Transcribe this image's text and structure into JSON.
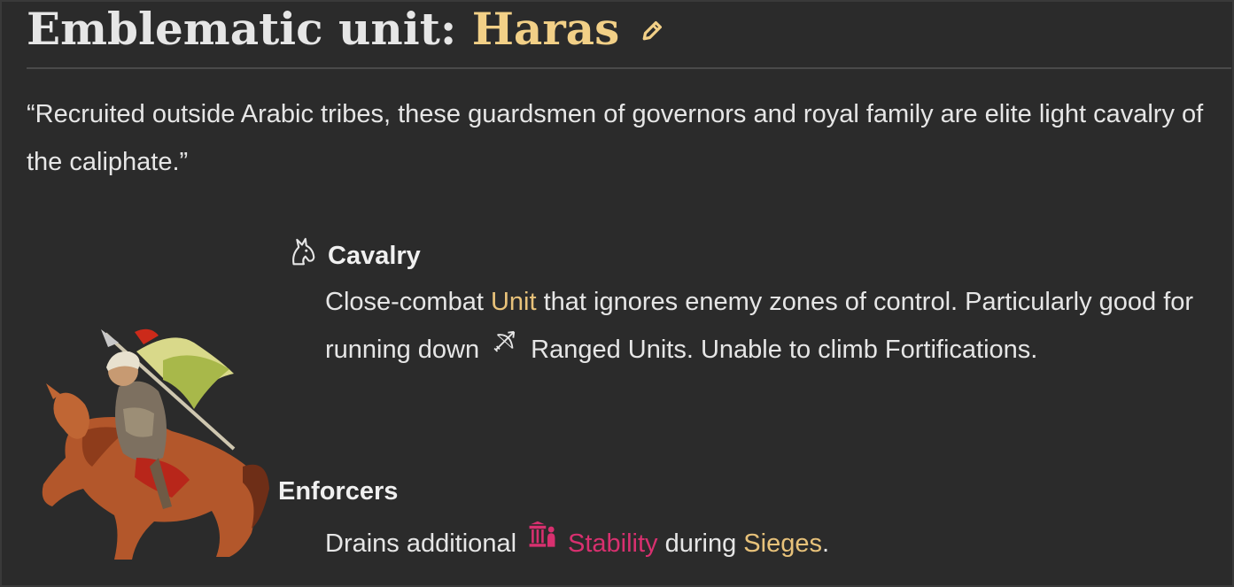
{
  "header": {
    "title_prefix": "Emblematic unit: ",
    "unit_name": "Haras",
    "edit_icon": "pencil-icon"
  },
  "quote": "“Recruited outside Arabic tribes, these guardsmen of governors and royal family are elite light cavalry of the caliphate.”",
  "traits": {
    "cavalry": {
      "icon": "horse-head-icon",
      "title": "Cavalry",
      "text_1": "Close-combat ",
      "link_unit": "Unit",
      "text_2": " that ignores enemy zones of control. Particularly good for running down",
      "ranged_icon": "bow-arrow-icon",
      "text_3": "Ranged Units. Unable to climb Fortifications."
    },
    "enforcers": {
      "title": "Enforcers",
      "text_1": "Drains additional",
      "stability_icon": "stability-icon",
      "link_stability": "Stability",
      "text_2": " during ",
      "link_sieges": "Sieges",
      "text_3": "."
    }
  },
  "colors": {
    "background": "#2b2b2b",
    "accent_gold": "#f2d087",
    "link_gold": "#e8c27a",
    "stability_pink": "#d8306f"
  }
}
